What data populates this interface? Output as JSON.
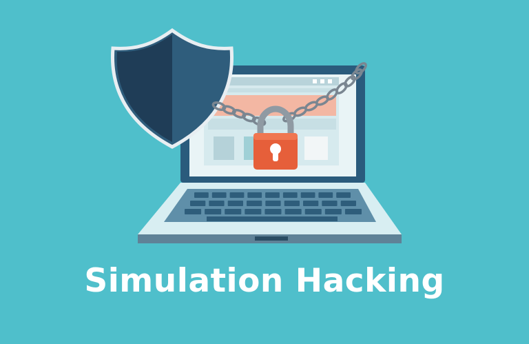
{
  "banner": {
    "title": "Simulation Hacking"
  },
  "illustration": {
    "icons": [
      "shield-icon",
      "laptop-icon",
      "chain-icon",
      "padlock-icon"
    ]
  },
  "colors": {
    "background": "#4fbfcb",
    "shield_dark": "#1f3d57",
    "shield_light": "#2f5d7c",
    "laptop_frame": "#2a5b7c",
    "screen": "#dbeef1",
    "padlock": "#e65f3a",
    "chain": "#7a8691",
    "text": "#ffffff"
  }
}
